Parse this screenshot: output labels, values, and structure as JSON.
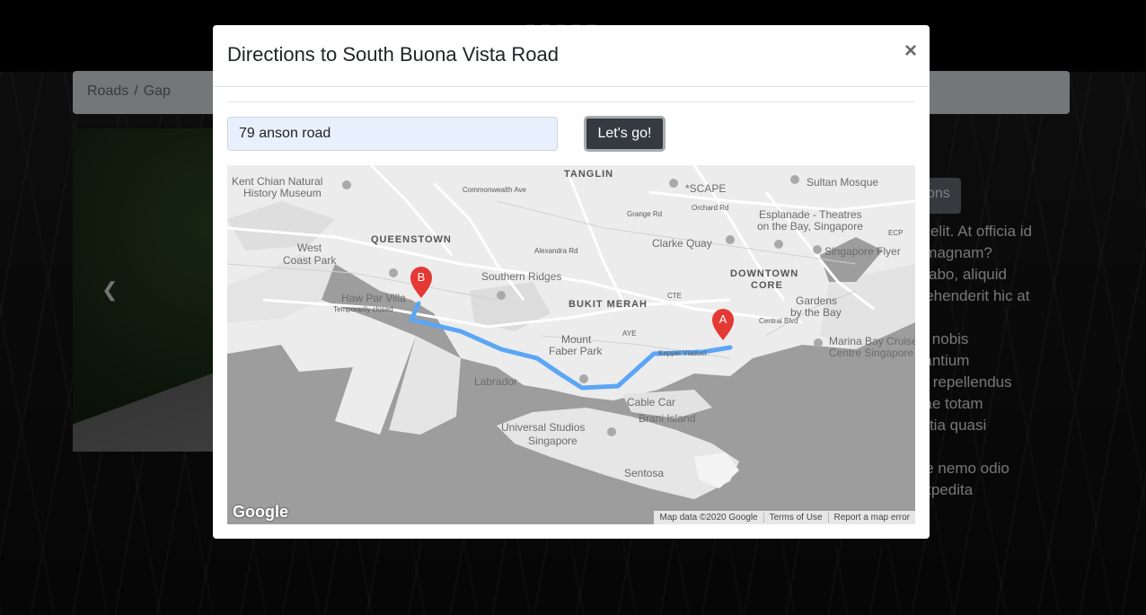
{
  "background": {
    "breadcrumb": [
      "Roads",
      "Gap"
    ],
    "side_button_label": "ons",
    "side_text": "cing elit. At officia id\nore magnam?\nxplicabo, aliquid\nreprehenderit hic at\nm.\nnem nobis\naudantium\nditiis repellendus\nandae totam\nmollitia quasi\n\nilique nemo odio\nm expedita"
  },
  "modal": {
    "title": "Directions to South Buona Vista Road",
    "close_label": "×",
    "address_input_value": "79 anson road",
    "go_button_label": "Let's go!"
  },
  "map": {
    "districts": [
      "TANGLIN",
      "QUEENSTOWN",
      "BUKIT MERAH",
      "DOWNTOWN",
      "CORE"
    ],
    "places": [
      "Kent Chian Natural",
      "History Museum",
      "West",
      "Coast Park",
      "Haw Par Villa",
      "Temporarily closed",
      "Southern Ridges",
      "Mount",
      "Faber Park",
      "Labrador",
      "Cable Car",
      "Brani Island",
      "Universal Studios",
      "Singapore",
      "Sentosa",
      "Clarke Quay",
      "*SCAPE",
      "Sultan Mosque",
      "Esplanade - Theatres",
      "on the Bay, Singapore",
      "Singapore Flyer",
      "Gardens",
      "by the Bay",
      "Marina Bay Cruise",
      "Centre Singapore",
      "ECP",
      "Keppel Viaduct",
      "AYE",
      "CTE",
      "Central Blvd",
      "Commonwealth Ave",
      "Alexandra Rd",
      "Grange Rd",
      "Orchard Rd"
    ],
    "marker_a": "A",
    "marker_b": "B",
    "logo": "Google",
    "attribution": [
      "Map data ©2020 Google",
      "Terms of Use",
      "Report a map error"
    ],
    "route_color": "#5ba6f5",
    "marker_color": "#e53935"
  }
}
